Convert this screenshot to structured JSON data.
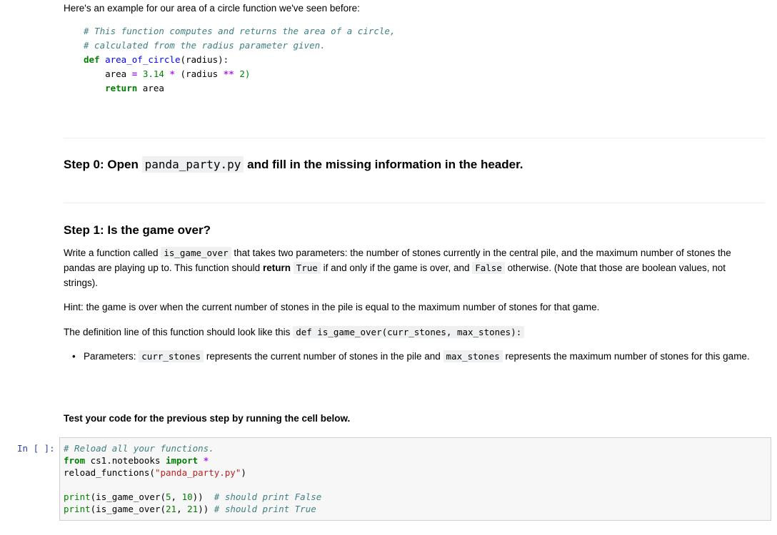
{
  "intro": {
    "text": "Here's an example for our area of a circle function we've seen before:"
  },
  "example_code": {
    "line1": "# This function computes and returns the area of a circle,",
    "line2": "# calculated from the radius parameter given.",
    "def_kw": "def",
    "func_name": "area_of_circle",
    "func_params": "(radius):",
    "area_var": "area",
    "eq": "=",
    "pi": "3.14",
    "mul": "*",
    "paren_radius": "(radius",
    "pow": "**",
    "two": "2)",
    "return_kw": "return",
    "return_val": "area"
  },
  "step0": {
    "prefix": "Step 0: Open ",
    "file": "panda_party.py",
    "suffix": " and fill in the missing information in the header."
  },
  "step1": {
    "title": "Step 1: Is the game over?",
    "p1_a": "Write a function called ",
    "p1_code1": "is_game_over",
    "p1_b": " that takes two parameters: the number of stones currently in the central pile, and the maximum number of stones the pandas are playing up to. This function should ",
    "p1_bold": "return",
    "p1_c": " ",
    "p1_code2": "True",
    "p1_d": " if and only if the game is over, and ",
    "p1_code3": "False",
    "p1_e": " otherwise. (Note that those are boolean values, not strings).",
    "hint": "Hint: the game is over when the current number of stones in the pile is equal to the maximum number of stones for that game.",
    "def_prefix": "The definition line of this function should look like this ",
    "def_code": "def is_game_over(curr_stones, max_stones):",
    "param_a": "Parameters: ",
    "param_code1": "curr_stones",
    "param_b": " represents the current number of stones in the pile and ",
    "param_code2": "max_stones",
    "param_c": " represents the maximum number of stones for this game."
  },
  "test_label": "Test your code for the previous step by running the cell below.",
  "cell": {
    "prompt": "In [ ]:",
    "l1_comment": "# Reload all your functions.",
    "l2_from": "from",
    "l2_mod": " cs1.notebooks ",
    "l2_import": "import",
    "l2_star": "*",
    "l3_call": "reload_functions(",
    "l3_str": "\"panda_party.py\"",
    "l3_end": ")",
    "l5_print": "print",
    "l5_a": "(is_game_over(",
    "l5_n1": "5",
    "l5_sep": ", ",
    "l5_n2": "10",
    "l5_end": "))  ",
    "l5_comment": "# should print False",
    "l6_print": "print",
    "l6_a": "(is_game_over(",
    "l6_n1": "21",
    "l6_sep": ", ",
    "l6_n2": "21",
    "l6_end": ")) ",
    "l6_comment": "# should print True"
  }
}
